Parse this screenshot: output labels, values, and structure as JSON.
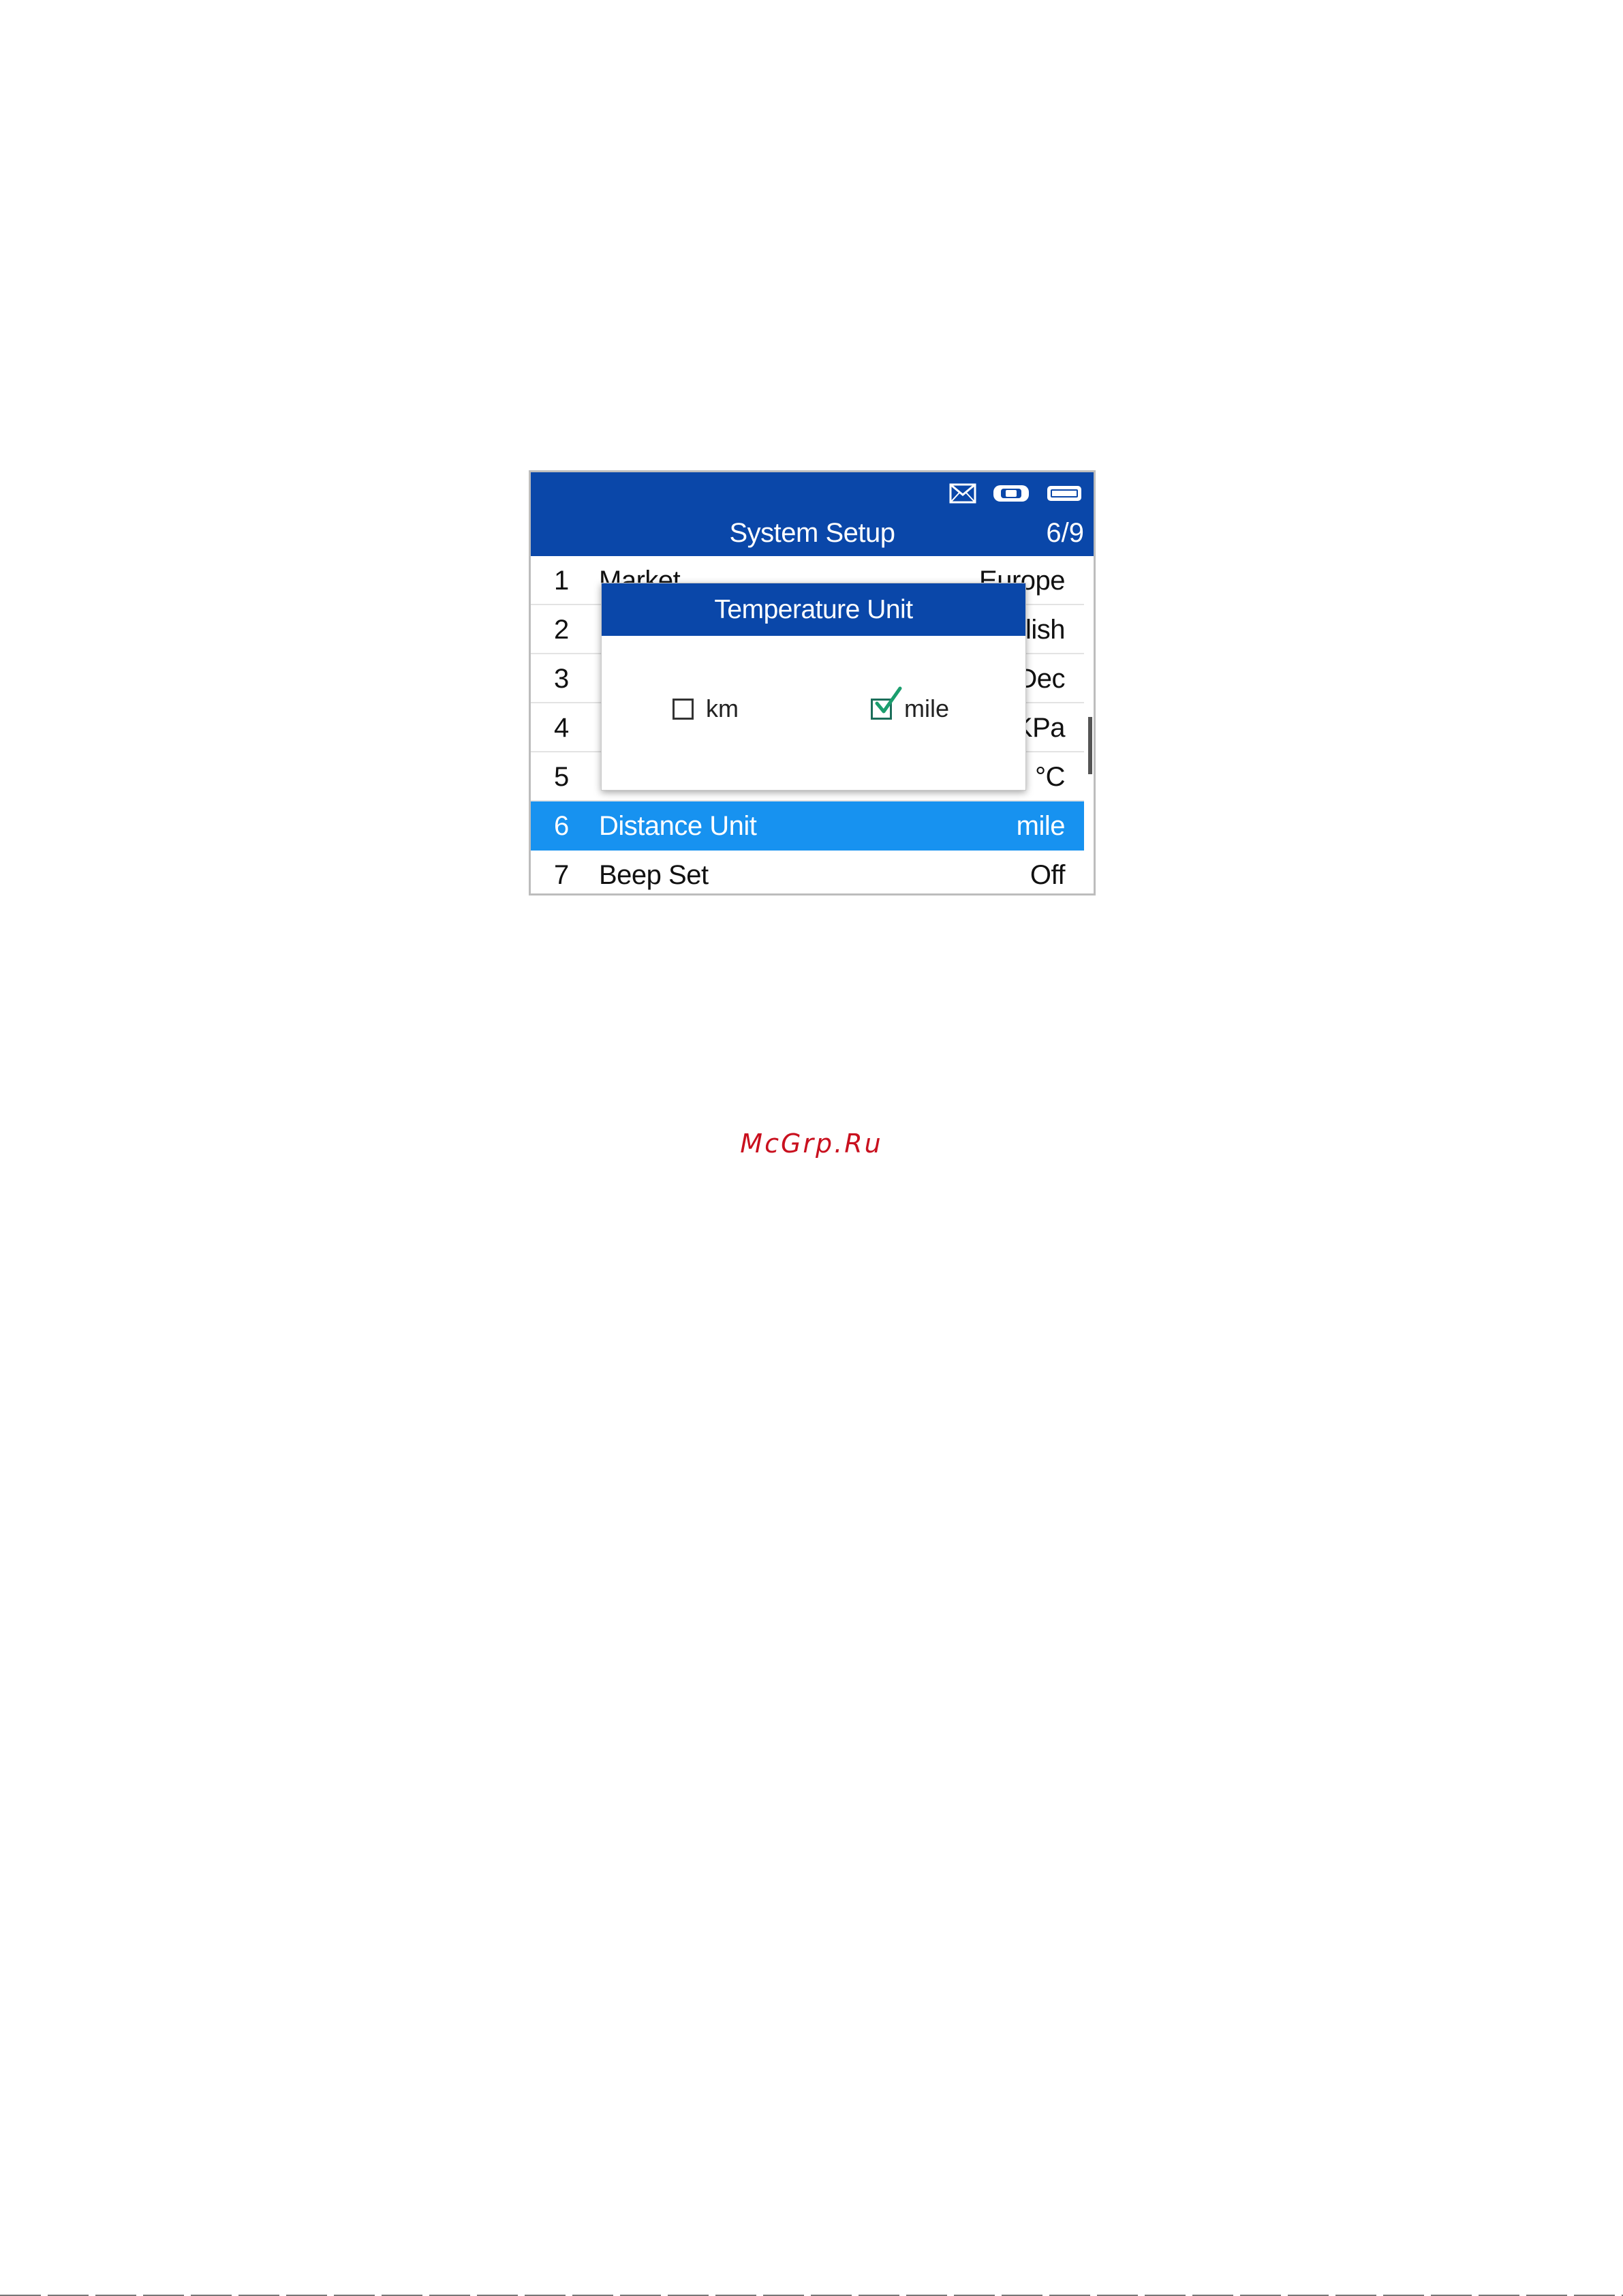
{
  "header": {
    "title": "System Setup",
    "page_indicator": "6/9",
    "status_icons": [
      "mail-icon",
      "vehicle-connection-icon",
      "battery-icon"
    ]
  },
  "menu": {
    "items": [
      {
        "num": "1",
        "label": "Market",
        "value": "Europe"
      },
      {
        "num": "2",
        "label": "",
        "value": "lish"
      },
      {
        "num": "3",
        "label": "",
        "value": "Dec"
      },
      {
        "num": "4",
        "label": "",
        "value": "KPa"
      },
      {
        "num": "5",
        "label": "",
        "value": "°C"
      },
      {
        "num": "6",
        "label": "Distance Unit",
        "value": "mile",
        "selected": true
      },
      {
        "num": "7",
        "label": "Beep Set",
        "value": "Off"
      }
    ]
  },
  "dialog": {
    "title": "Temperature Unit",
    "options": [
      {
        "label": "km",
        "checked": false
      },
      {
        "label": "mile",
        "checked": true
      }
    ]
  },
  "watermark": "McGrp.Ru",
  "colors": {
    "header_blue": "#0a47a9",
    "selected_row": "#1792f0",
    "check_green": "#1b9e6e",
    "watermark_red": "#c9101e"
  }
}
